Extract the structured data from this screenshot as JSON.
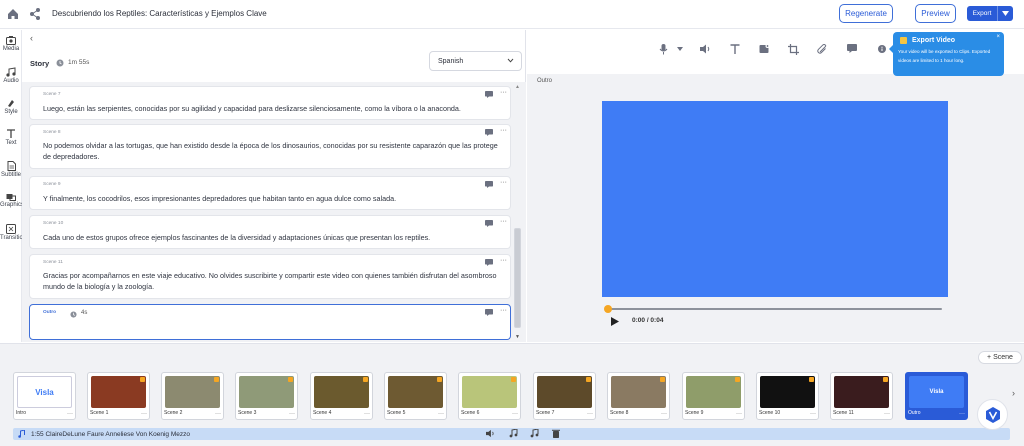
{
  "header": {
    "title": "Descubriendo los Reptiles: Características y Ejemplos Clave",
    "regenerate": "Regenerate",
    "preview": "Preview",
    "export": "Export"
  },
  "nav": [
    {
      "label": "Media",
      "icon": "media-icon"
    },
    {
      "label": "Audio",
      "icon": "music-icon"
    },
    {
      "label": "Style",
      "icon": "style-icon"
    },
    {
      "label": "Text",
      "icon": "text-icon"
    },
    {
      "label": "Subtitle",
      "icon": "subtitle-icon"
    },
    {
      "label": "Graphics",
      "icon": "graphics-icon"
    },
    {
      "label": "Transition",
      "icon": "transition-icon"
    }
  ],
  "story": {
    "back": "‹",
    "label": "Story",
    "duration": "1m 55s",
    "language": "Spanish",
    "scenes": [
      {
        "name": "Scene 7",
        "text": "Luego, están las serpientes, conocidas por su agilidad y capacidad para deslizarse silenciosamente, como la víbora o la anaconda."
      },
      {
        "name": "Scene 8",
        "text": "No podemos olvidar a las tortugas, que han existido desde la época de los dinosaurios, conocidas por su resistente caparazón que las protege de depredadores."
      },
      {
        "name": "Scene 9",
        "text": "Y finalmente, los cocodrilos, esos impresionantes depredadores que habitan tanto en agua dulce como salada."
      },
      {
        "name": "Scene 10",
        "text": "Cada uno de estos grupos ofrece ejemplos fascinantes de la diversidad y adaptaciones únicas que presentan los reptiles."
      },
      {
        "name": "Scene 11",
        "text": "Gracias por acompañarnos en este viaje educativo. No olvides suscribirte y compartir este video con quienes también disfrutan del asombroso mundo de la biología y la zoología."
      }
    ],
    "outro": {
      "name": "Outro",
      "duration": "4s"
    }
  },
  "preview": {
    "scene_label": "Outro",
    "time": "0:00 / 0:04",
    "progress": 0,
    "canvas_color": "#3f7cf5"
  },
  "tooltip": {
    "title": "Export Video",
    "body": "Your video will be exported to Clips. Exported videos are limited to 1 hour long.",
    "close": "×"
  },
  "timeline": {
    "add_scene": "+ Scene",
    "thumbs": [
      {
        "name": "Intro",
        "color": "#ffffff"
      },
      {
        "name": "Scene 1",
        "color": "#8a3a22"
      },
      {
        "name": "Scene 2",
        "color": "#8c8a70"
      },
      {
        "name": "Scene 3",
        "color": "#8f9a78"
      },
      {
        "name": "Scene 4",
        "color": "#6b5a2e"
      },
      {
        "name": "Scene 5",
        "color": "#6e5a32"
      },
      {
        "name": "Scene 6",
        "color": "#b9c57a"
      },
      {
        "name": "Scene 7",
        "color": "#5d4a2a"
      },
      {
        "name": "Scene 8",
        "color": "#8a7a62"
      },
      {
        "name": "Scene 9",
        "color": "#8f9d6a"
      },
      {
        "name": "Scene 10",
        "color": "#111111"
      },
      {
        "name": "Scene 11",
        "color": "#3a1c1e"
      },
      {
        "name": "Outro",
        "color": "#3f7cf5"
      }
    ],
    "intro_logo": "Visla",
    "outro_logo": "Visla",
    "audio": "1:55  ClaireDeLune Faure Anneliese Von Koenig Mezzo"
  }
}
